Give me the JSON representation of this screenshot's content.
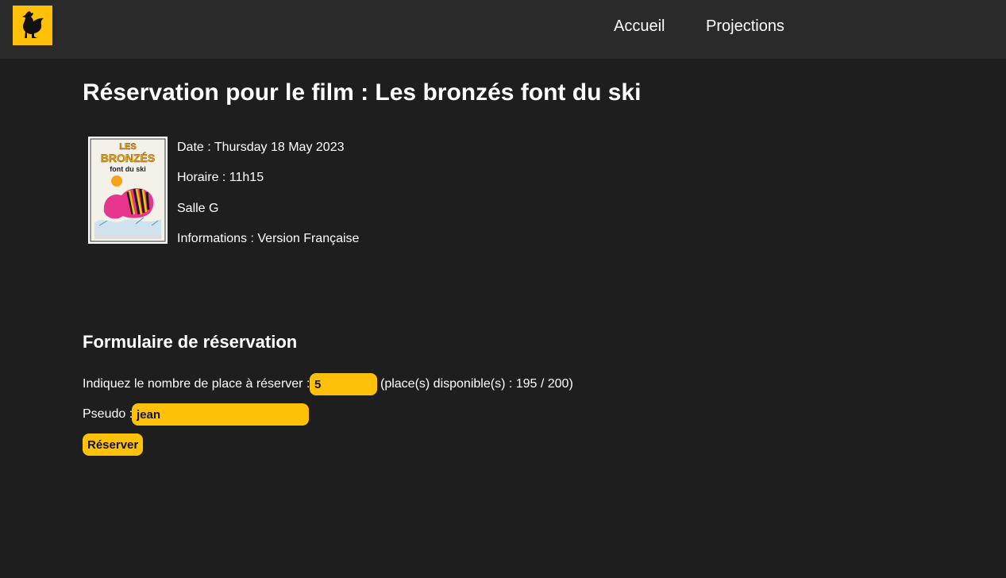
{
  "nav": {
    "links": [
      "Accueil",
      "Projections"
    ],
    "logo_icon": "rooster-icon",
    "accent_color": "#ffc107"
  },
  "page": {
    "title": "Réservation pour le film : Les bronzés font du ski"
  },
  "poster": {
    "title_line1": "LES",
    "title_line2": "BRONZÉS",
    "title_line3": "font du ski"
  },
  "screening": {
    "date": "Date : Thursday 18 May 2023",
    "time": "Horaire : 11h15",
    "room": "Salle G",
    "info": "Informations : Version Française"
  },
  "form": {
    "title": "Formulaire de réservation",
    "places_label": "Indiquez le nombre de place à réserver :",
    "places_value": "5",
    "available_text": "(place(s) disponible(s) : 195 / 200)",
    "pseudo_label": "Pseudo :",
    "pseudo_value": "jean",
    "submit_label": "Réserver"
  }
}
